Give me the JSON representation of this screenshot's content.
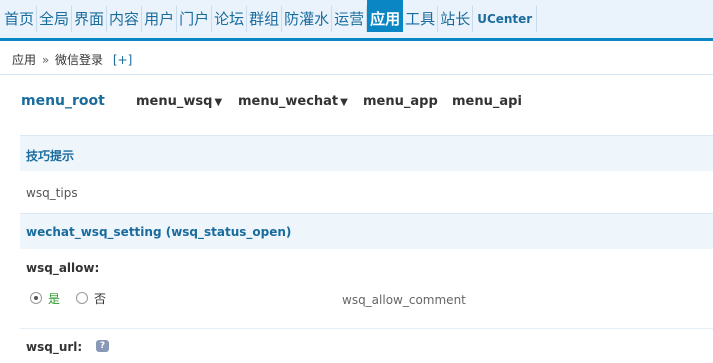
{
  "nav": {
    "items": [
      "首页",
      "全局",
      "界面",
      "内容",
      "用户",
      "门户",
      "论坛",
      "群组",
      "防灌水",
      "运营",
      "应用",
      "工具",
      "站长",
      "UCenter"
    ],
    "active": "应用"
  },
  "breadcrumb": {
    "parent": "应用",
    "separator": "»",
    "current": "微信登录",
    "add": "[+]"
  },
  "menu": {
    "root": "menu_root",
    "wsq": "menu_wsq",
    "wechat": "menu_wechat",
    "app": "menu_app",
    "api": "menu_api"
  },
  "tips_section": {
    "title": "技巧提示",
    "text": "wsq_tips"
  },
  "setting_section": {
    "title": "wechat_wsq_setting (wsq_status_open)"
  },
  "wsq_allow": {
    "label": "wsq_allow:",
    "yes_label": "是",
    "no_label": "否",
    "selected": "是",
    "comment": "wsq_allow_comment"
  },
  "wsq_url": {
    "label": "wsq_url:"
  },
  "icons": {
    "caret": "caret-down-icon",
    "help": "help-icon"
  },
  "colors": {
    "accent": "#0a86c5",
    "link": "#1a6c9e",
    "yes": "#2a9a2a"
  }
}
